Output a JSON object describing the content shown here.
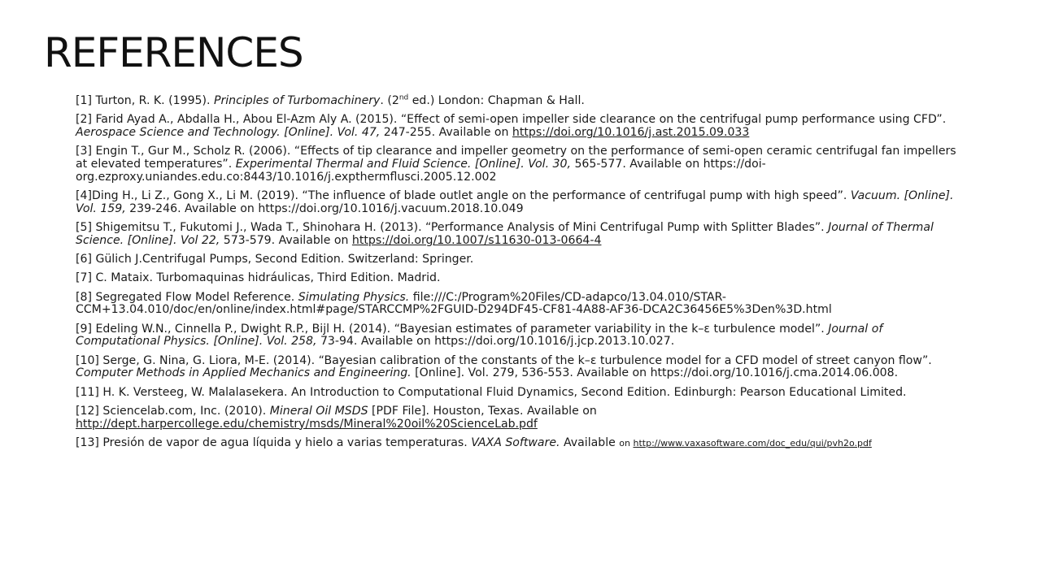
{
  "slide": {
    "title": "REFERENCES"
  },
  "references": [
    {
      "a": "[1] Turton, R. K. (1995). ",
      "b": "Principles of Turbomachinery",
      "c": ". (2",
      "sup": "nd",
      "d": " ed.) London: Chapman & Hall."
    },
    {
      "a": "[2] Farid Ayad A., Abdalla H., Abou El-Azm Aly A. (2015). “Effect of semi-open impeller side clearance on the centrifugal pump performance using CFD”. ",
      "b": "Aerospace Science and Technology. [Online]. Vol. 47,",
      "c": " 247-255. Available on ",
      "link": "https://doi.org/10.1016/j.ast.2015.09.033"
    },
    {
      "a": "[3] Engin T., Gur M., Scholz R. (2006). “Effects of tip clearance and impeller geometry on the performance of semi-open ceramic centrifugal fan impellers at elevated temperatures”. ",
      "b": "Experimental Thermal and Fluid Science. [Online]. Vol. 30,",
      "c": " 565-577. Available on https://doi-org.ezproxy.uniandes.edu.co:8443/10.1016/j.expthermflusci.2005.12.002"
    },
    {
      "a": "[4]Ding H., Li Z., Gong X., Li M. (2019). “The influence of blade outlet angle on the performance of centrifugal pump with high speed”. ",
      "b": "Vacuum. [Online]. Vol. 159,",
      "c": " 239-246. Available on https://doi.org/10.1016/j.vacuum.2018.10.049"
    },
    {
      "a": "[5] Shigemitsu T., Fukutomi J., Wada T., Shinohara H. (2013). “Performance Analysis of Mini Centrifugal Pump with Splitter Blades”. ",
      "b": "Journal of Thermal Science. [Online]. Vol 22,",
      "c": " 573-579. Available on ",
      "link": "https://doi.org/10.1007/s11630-013-0664-4"
    },
    {
      "a": "[6] Gülich J.Centrifugal Pumps, Second Edition. Switzerland: Springer."
    },
    {
      "a": "[7] C. Mataix. Turbomaquinas hidráulicas, Third Edition. Madrid."
    },
    {
      "a": "[8] Segregated Flow Model Reference. ",
      "b": "Simulating Physics.",
      "c": " file:///C:/Program%20Files/CD-adapco/13.04.010/STAR-CCM+13.04.010/doc/en/online/index.html#page/STARCCMP%2FGUID-D294DF45-CF81-4A88-AF36-DCA2C36456E5%3Den%3D.html"
    },
    {
      "a": "[9] Edeling W.N., Cinnella P., Dwight R.P., Bijl H. (2014). “Bayesian estimates of parameter variability in the k–ε turbulence model”. ",
      "b": "Journal of Computational Physics. [Online]. Vol. 258,",
      "c": " 73-94. Available on https://doi.org/10.1016/j.jcp.2013.10.027."
    },
    {
      "a": "[10] Serge, G. Nina, G. Liora, M-E. (2014). “Bayesian calibration of the constants of the k–ε turbulence model for a CFD model of street canyon flow”. ",
      "b": "Computer Methods in Applied Mechanics and Engineering.",
      "c": " [Online]. Vol. 279, 536-553. Available on https://doi.org/10.1016/j.cma.2014.06.008."
    },
    {
      "a": "[11] H. K. Versteeg, W. Malalasekera. An Introduction to Computational Fluid Dynamics, Second Edition. Edinburgh: Pearson Educational Limited."
    },
    {
      "a": "[12] Sciencelab.com, Inc. (2010). ",
      "b": "Mineral Oil MSDS",
      "c": " [PDF File]. Houston, Texas. Available on ",
      "link": "http://dept.harpercollege.edu/chemistry/msds/Mineral%20oil%20ScienceLab.pdf"
    },
    {
      "a": "[13] Presión de vapor de agua líquida y hielo a varias temperaturas. ",
      "b": "VAXA Software.",
      "c": " Available ",
      "small": "on ",
      "link": "http://www.vaxasoftware.com/doc_edu/qui/pvh2o.pdf"
    }
  ]
}
